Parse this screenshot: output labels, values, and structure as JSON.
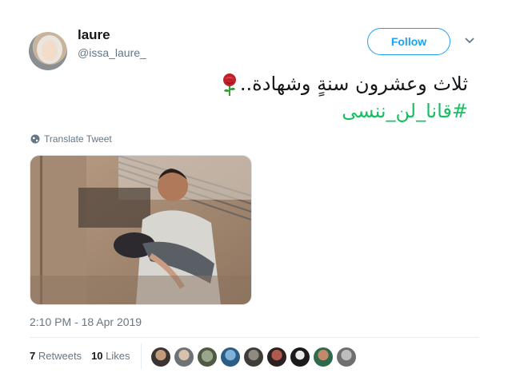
{
  "user": {
    "display_name": "laure",
    "handle": "@issa_laure_"
  },
  "follow_label": "Follow",
  "tweet": {
    "line1": "ثلاث وعشرون سنةٍ وشهادة..",
    "hashtag": "#قانا_لن_ننسى",
    "emoji": "rose"
  },
  "translate_label": "Translate Tweet",
  "timestamp": "2:10 PM - 18 Apr 2019",
  "stats": {
    "retweets_count": "7",
    "retweets_label": "Retweets",
    "likes_count": "10",
    "likes_label": "Likes"
  },
  "likers": [
    {
      "avatar": "avatar-1"
    },
    {
      "avatar": "avatar-2"
    },
    {
      "avatar": "avatar-3"
    },
    {
      "avatar": "avatar-4"
    },
    {
      "avatar": "avatar-5"
    },
    {
      "avatar": "avatar-6"
    },
    {
      "avatar": "avatar-7"
    },
    {
      "avatar": "avatar-8"
    },
    {
      "avatar": "avatar-9"
    }
  ],
  "colors": {
    "accent": "#1da1f2",
    "hashtag": "#17bf63",
    "muted": "#657786"
  }
}
